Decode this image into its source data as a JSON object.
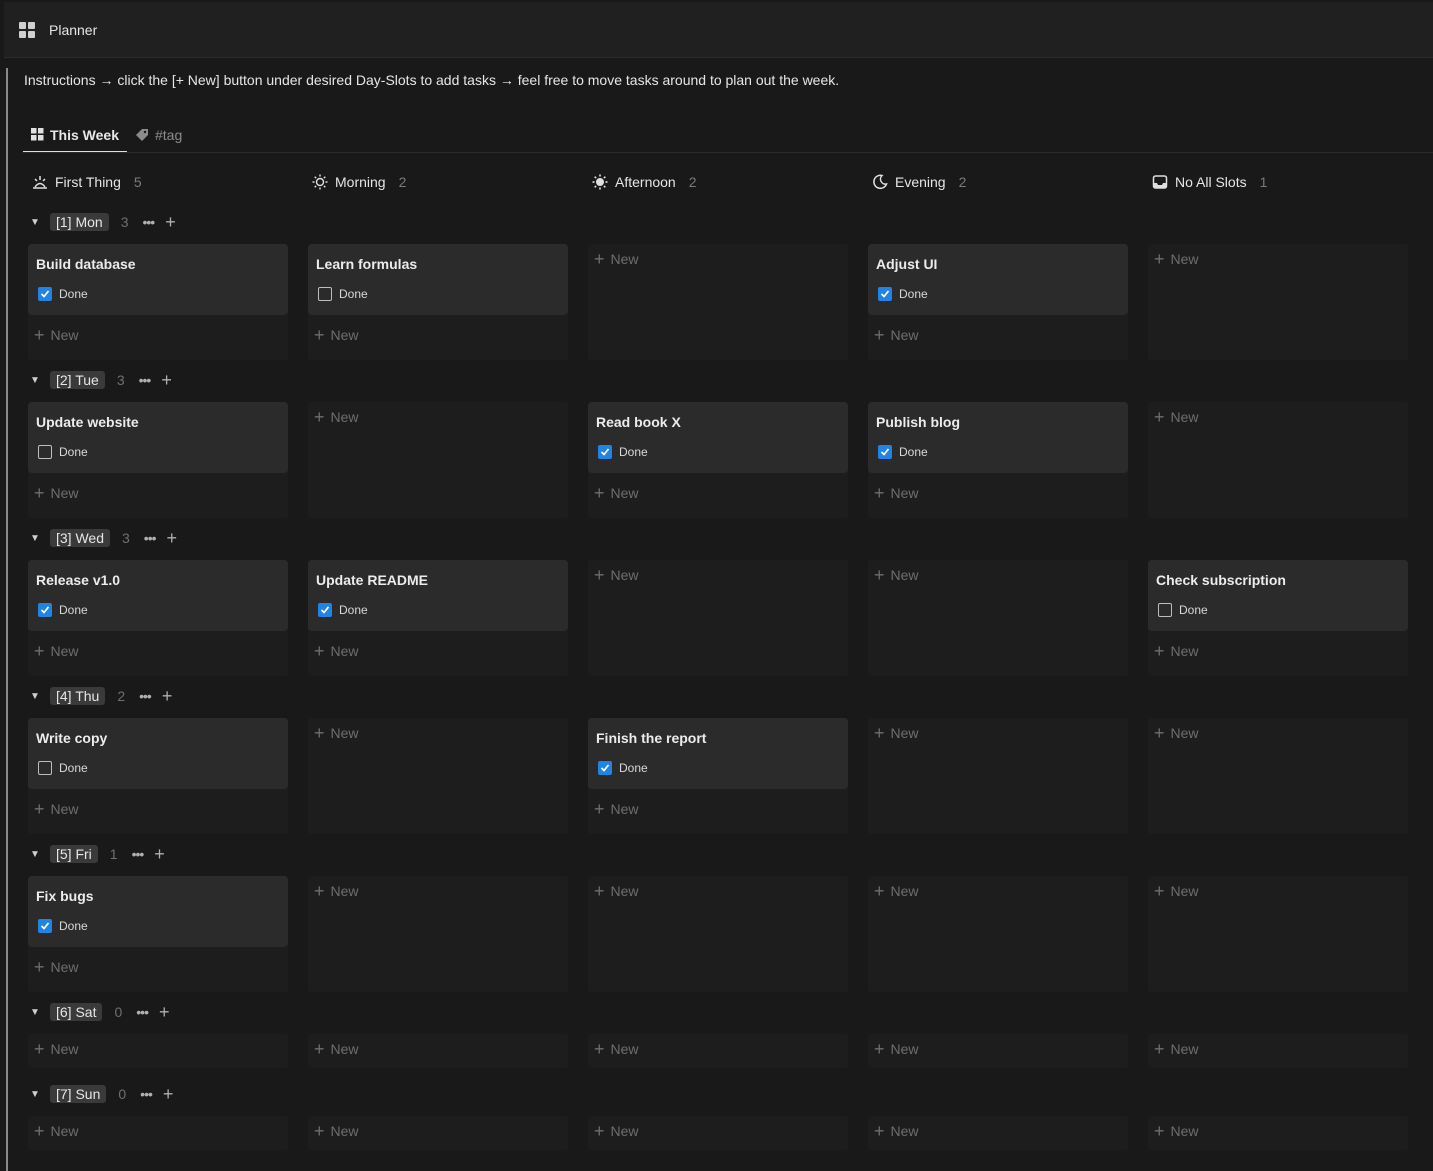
{
  "app": {
    "title": "Planner",
    "icon": "grid-icon"
  },
  "instructions": "Instructions → click the [+ New] button under desired Day-Slots to add tasks → feel free to move tasks around to plan out the week.",
  "tabs": [
    {
      "label": "This Week",
      "icon": "board-icon",
      "active": true
    },
    {
      "label": "#tag",
      "icon": "tag-icon",
      "active": false
    }
  ],
  "columns": [
    {
      "label": "First Thing",
      "count": "5",
      "icon": "sunrise-icon"
    },
    {
      "label": "Morning",
      "count": "2",
      "icon": "sun-outline-icon"
    },
    {
      "label": "Afternoon",
      "count": "2",
      "icon": "sun-filled-icon"
    },
    {
      "label": "Evening",
      "count": "2",
      "icon": "moon-icon"
    },
    {
      "label": "No All Slots",
      "count": "1",
      "icon": "inbox-icon"
    }
  ],
  "new_label": "New",
  "done_label": "Done",
  "groups": [
    {
      "label": "[1] Mon",
      "count": "3",
      "cells": [
        {
          "title": "Build database",
          "done": true
        },
        {
          "title": "Learn formulas",
          "done": false
        },
        null,
        {
          "title": "Adjust UI",
          "done": true
        },
        null
      ]
    },
    {
      "label": "[2] Tue",
      "count": "3",
      "cells": [
        {
          "title": "Update website",
          "done": false
        },
        null,
        {
          "title": "Read book X",
          "done": true
        },
        {
          "title": "Publish blog",
          "done": true
        },
        null
      ]
    },
    {
      "label": "[3] Wed",
      "count": "3",
      "cells": [
        {
          "title": "Release v1.0",
          "done": true
        },
        {
          "title": "Update README",
          "done": true
        },
        null,
        null,
        {
          "title": "Check subscription",
          "done": false
        }
      ]
    },
    {
      "label": "[4] Thu",
      "count": "2",
      "cells": [
        {
          "title": "Write copy",
          "done": false
        },
        null,
        {
          "title": "Finish the report",
          "done": true
        },
        null,
        null
      ]
    },
    {
      "label": "[5] Fri",
      "count": "1",
      "cells": [
        {
          "title": "Fix bugs",
          "done": true
        },
        null,
        null,
        null,
        null
      ]
    },
    {
      "label": "[6] Sat",
      "count": "0",
      "cells": [
        null,
        null,
        null,
        null,
        null
      ]
    },
    {
      "label": "[7] Sun",
      "count": "0",
      "cells": [
        null,
        null,
        null,
        null,
        null
      ]
    }
  ]
}
